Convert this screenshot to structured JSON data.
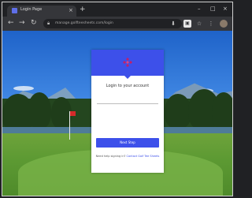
{
  "browser": {
    "tab_title": "Login Page",
    "tab_close": "×",
    "new_tab": "+",
    "window_controls": [
      "–",
      "□",
      "×"
    ],
    "url": "manage.golfteesheets.com/login",
    "nav": {
      "back": "←",
      "forward": "→",
      "reload": "↻"
    },
    "toolbar_icons": [
      "⬇",
      "▣",
      "☆",
      "⋮"
    ]
  },
  "login": {
    "heading": "Login to your account",
    "username_placeholder": "",
    "button_label": "Next Step",
    "footer_text": "Need help signing in?",
    "footer_link": "Contact Golf Tee Sheets"
  },
  "colors": {
    "brand": "#3d50ea",
    "logo": "#c21f6a"
  },
  "icons": {
    "logo": "diamond-cluster-logo",
    "lock": "lock-icon"
  }
}
